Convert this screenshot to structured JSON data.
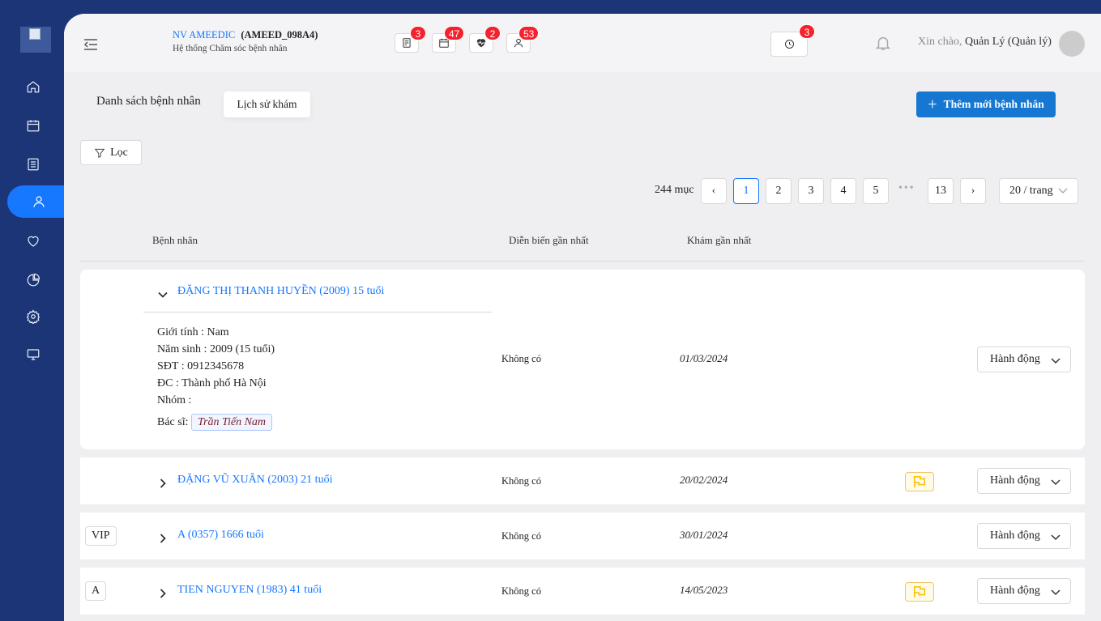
{
  "sidebar": {
    "items": [
      {
        "icon": "home-icon"
      },
      {
        "icon": "calendar-icon"
      },
      {
        "icon": "list-icon"
      },
      {
        "icon": "user-icon",
        "active": true
      },
      {
        "icon": "heart-icon"
      },
      {
        "icon": "pie-chart-icon"
      },
      {
        "icon": "gear-icon"
      },
      {
        "icon": "monitor-icon"
      }
    ]
  },
  "header": {
    "brand": "NV AMEEDIC",
    "code": "(AMEED_098A4)",
    "subtitle": "Hệ thống Chăm sóc bệnh nhân",
    "icons": [
      {
        "icon": "document-icon",
        "badge": "3"
      },
      {
        "icon": "calendar-icon",
        "badge": "47"
      },
      {
        "icon": "heartbeat-icon",
        "badge": "2"
      },
      {
        "icon": "user-icon",
        "badge": "53"
      }
    ],
    "history_badge": "3",
    "greeting": "Xin chào,",
    "user": "Quản Lý (Quản lý)"
  },
  "page": {
    "title": "Danh sách bệnh nhân",
    "history_tab": "Lịch sử khám",
    "add_button": "Thêm mới bệnh nhân",
    "filter_button": "Lọc"
  },
  "pagination": {
    "total": "244 mục",
    "pages": [
      "1",
      "2",
      "3",
      "4",
      "5",
      "13"
    ],
    "current": "1",
    "per_page": "20 / trang"
  },
  "table": {
    "headers": {
      "patient": "Bệnh nhân",
      "progress": "Diễn biến gần nhất",
      "last_visit": "Khám gần nhất"
    },
    "rows": [
      {
        "name": "ĐẶNG THỊ THANH HUYỀN (2009) 15 tuổi",
        "progress": "Không có",
        "date": "01/03/2024",
        "action": "Hành động",
        "details": {
          "gender": "Giới tính : Nam",
          "birth": "Năm sinh : 2009 (15 tuổi)",
          "phone": "SĐT : 0912345678",
          "address": "ĐC : Thành phố Hà Nội",
          "group": "Nhóm :",
          "doctor_label": "Bác sĩ:",
          "doctor": "Trần Tiến Nam"
        }
      },
      {
        "name": "ĐẶNG VŨ XUÂN (2003) 21 tuổi",
        "progress": "Không có",
        "date": "20/02/2024",
        "action": "Hành động",
        "flag": true
      },
      {
        "tag": "VIP",
        "name": "A (0357) 1666 tuổi",
        "progress": "Không có",
        "date": "30/01/2024",
        "action": "Hành động"
      },
      {
        "tag": "A",
        "name": "TIEN NGUYEN (1983) 41 tuổi",
        "progress": "Không có",
        "date": "14/05/2023",
        "action": "Hành động",
        "flag": true
      }
    ]
  }
}
